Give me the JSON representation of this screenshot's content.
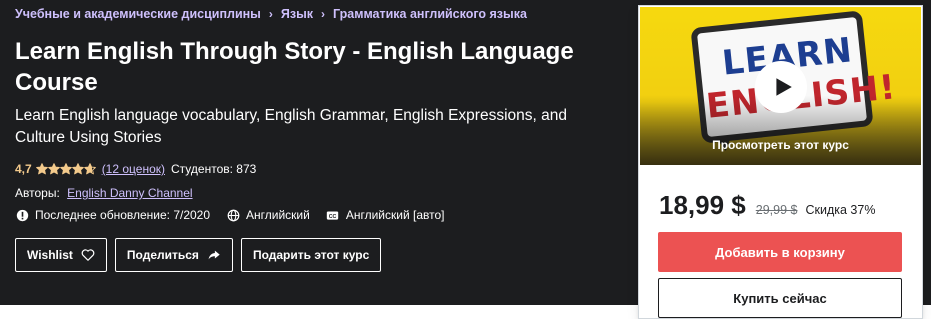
{
  "breadcrumb": {
    "items": [
      "Учебные и академические дисциплины",
      "Язык",
      "Грамматика английского языка"
    ]
  },
  "course": {
    "title": "Learn English Through Story - English Language Course",
    "subtitle": "Learn English language vocabulary, English Grammar, English Expressions, and Culture Using Stories",
    "rating": "4,7",
    "rating_value": 4.7,
    "rating_max": 5,
    "reviews": "(12 оценок)",
    "students": "Студентов: 873",
    "authors_label": "Авторы:",
    "author": "English Danny Channel",
    "last_updated": "Последнее обновление: 7/2020",
    "language": "Английский",
    "captions": "Английский [авто]"
  },
  "actions": {
    "wishlist": "Wishlist",
    "share": "Поделиться",
    "gift": "Подарить этот курс"
  },
  "sidebar": {
    "preview_image_text_top": "LEARN",
    "preview_image_text_bottom": "ENGLISH!",
    "preview_label": "Просмотреть этот курс",
    "price": "18,99 $",
    "old_price": "29,99 $",
    "discount": "Скидка 37%",
    "add_to_cart": "Добавить в корзину",
    "buy_now": "Купить сейчас"
  },
  "colors": {
    "hero_bg": "#1c1d1f",
    "link_purple": "#cec0fc",
    "rating_gold": "#f3ca8c",
    "cart_red": "#ec5252"
  },
  "icons": {
    "star": "star-icon",
    "update": "alert-icon",
    "language": "globe-icon",
    "captions": "captions-icon",
    "wishlist": "heart-icon",
    "share": "share-arrow-icon",
    "play": "play-icon",
    "breadcrumb_sep": "chevron-right-icon"
  }
}
